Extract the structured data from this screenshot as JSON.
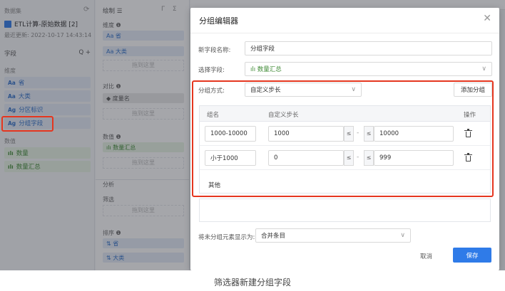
{
  "left_panel": {
    "dataset_title": "数据集",
    "dataset_name": "ETL计算-原始数据 [2]",
    "updated": "最近更新: 2022-10-17 14:43:14",
    "fields_header": "字段",
    "header_icons": "Q  +",
    "dimension_label": "维度",
    "dimensions": [
      {
        "type": "Aa",
        "name": "省"
      },
      {
        "type": "Aa",
        "name": "大类"
      },
      {
        "type": "Ag",
        "name": "分区标识"
      },
      {
        "type": "Ag",
        "name": "分组字段"
      }
    ],
    "measure_label": "数值",
    "measures": [
      {
        "type": "ılı",
        "name": "数量"
      },
      {
        "type": "ılı",
        "name": "数量汇总"
      }
    ]
  },
  "middle_panel": {
    "draw_label": "绘制 ☰",
    "header_icons": "Γ Σ",
    "dim_label": "维度 ❶",
    "dim_chips": [
      "Aa  省",
      "Aa  大类"
    ],
    "drop_hint": "拖到这里",
    "compare_label": "对比 ❶",
    "compare_chip": "◆  度量名",
    "value_label": "数值 ❶",
    "value_chip": "ılı  数量汇总",
    "analysis_label": "分析",
    "filter_label": "筛选",
    "sort_label": "排序 ❶",
    "sort_chips": [
      "⇅  省",
      "⇅  大类"
    ]
  },
  "dialog": {
    "title": "分组编辑器",
    "close": "✕",
    "new_field_label": "新字段名称:",
    "new_field_value": "分组字段",
    "select_field_label": "选择字段:",
    "select_field_value": "ılı  数量汇总",
    "group_method_label": "分组方式:",
    "group_method_value": "自定义步长",
    "add_group_button": "添加分组",
    "col_name": "组名",
    "col_step": "自定义步长",
    "col_action": "操作",
    "groups": [
      {
        "name": "1000-10000",
        "from": "1000",
        "op1": "≤",
        "to_op": "≤",
        "to": "10000"
      },
      {
        "name": "小于1000",
        "from": "0",
        "op1": "≤",
        "to_op": "≤",
        "to": "999"
      }
    ],
    "dash": "-",
    "other_label": "其他",
    "ungrouped_label": "将未分组元素显示为:",
    "ungrouped_value": "合并条目",
    "cancel_button": "取消",
    "save_button": "保存"
  },
  "caption": "筛选器新建分组字段"
}
